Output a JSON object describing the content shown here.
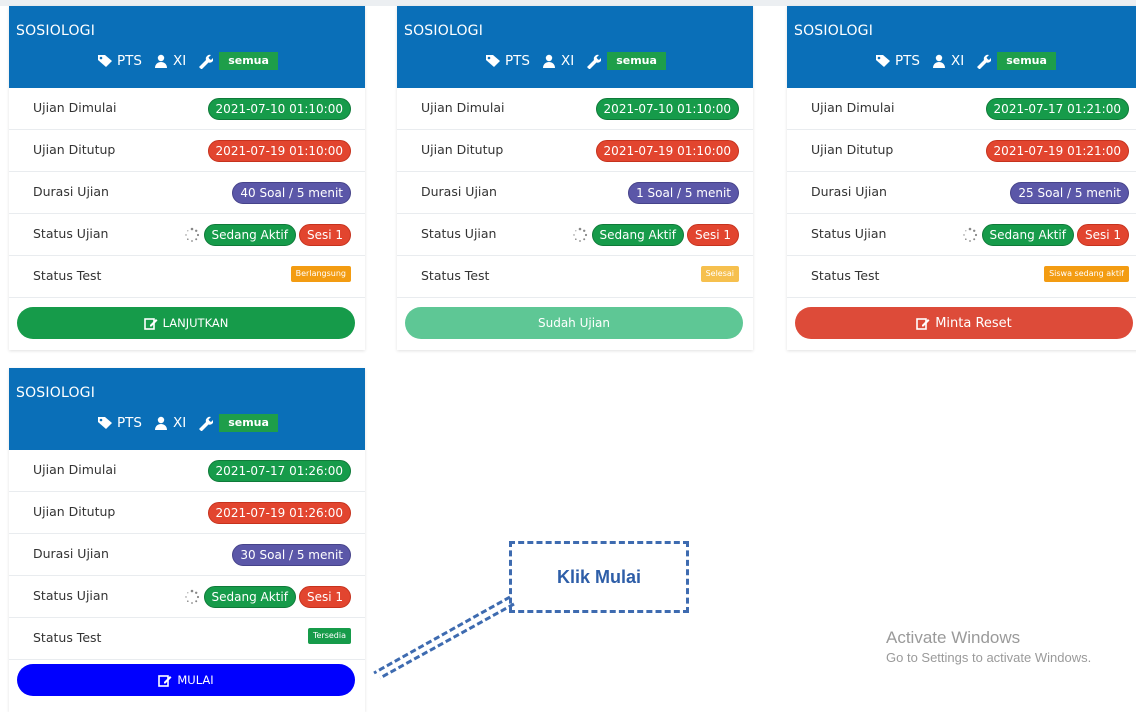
{
  "cards": [
    {
      "title": "SOSIOLOGI",
      "type": "PTS",
      "kelas": "XI",
      "group": "semua",
      "rows": {
        "mulai_label": "Ujian Dimulai",
        "mulai_value": "2021-07-10 01:10:00",
        "tutup_label": "Ujian Ditutup",
        "tutup_value": "2021-07-19 01:10:00",
        "durasi_label": "Durasi Ujian",
        "durasi_value": "40 Soal / 5 menit",
        "status_ujian_label": "Status Ujian",
        "status_ujian_value": "Sedang Aktif",
        "sesi": "Sesi 1",
        "status_test_label": "Status Test",
        "status_test_value": "Berlangsung"
      },
      "button": "LANJUTKAN"
    },
    {
      "title": "SOSIOLOGI",
      "type": "PTS",
      "kelas": "XI",
      "group": "semua",
      "rows": {
        "mulai_label": "Ujian Dimulai",
        "mulai_value": "2021-07-10 01:10:00",
        "tutup_label": "Ujian Ditutup",
        "tutup_value": "2021-07-19 01:10:00",
        "durasi_label": "Durasi Ujian",
        "durasi_value": "1 Soal / 5 menit",
        "status_ujian_label": "Status Ujian",
        "status_ujian_value": "Sedang Aktif",
        "sesi": "Sesi 1",
        "status_test_label": "Status Test",
        "status_test_value": "Selesai"
      },
      "button": "Sudah Ujian"
    },
    {
      "title": "SOSIOLOGI",
      "type": "PTS",
      "kelas": "XI",
      "group": "semua",
      "rows": {
        "mulai_label": "Ujian Dimulai",
        "mulai_value": "2021-07-17 01:21:00",
        "tutup_label": "Ujian Ditutup",
        "tutup_value": "2021-07-19 01:21:00",
        "durasi_label": "Durasi Ujian",
        "durasi_value": "25 Soal / 5 menit",
        "status_ujian_label": "Status Ujian",
        "status_ujian_value": "Sedang Aktif",
        "sesi": "Sesi 1",
        "status_test_label": "Status Test",
        "status_test_value": "Siswa sedang aktif"
      },
      "button": "Minta Reset"
    },
    {
      "title": "SOSIOLOGI",
      "type": "PTS",
      "kelas": "XI",
      "group": "semua",
      "rows": {
        "mulai_label": "Ujian Dimulai",
        "mulai_value": "2021-07-17 01:26:00",
        "tutup_label": "Ujian Ditutup",
        "tutup_value": "2021-07-19 01:26:00",
        "durasi_label": "Durasi Ujian",
        "durasi_value": "30 Soal / 5 menit",
        "status_ujian_label": "Status Ujian",
        "status_ujian_value": "Sedang Aktif",
        "sesi": "Sesi 1",
        "status_test_label": "Status Test",
        "status_test_value": "Tersedia"
      },
      "button": "MULAI"
    }
  ],
  "callout": "Klik Mulai",
  "watermark": {
    "line1": "Activate Windows",
    "line2": "Go to Settings to activate Windows."
  },
  "icons": {
    "type": "tag-icon",
    "kelas": "user-icon",
    "group": "wrench-icon",
    "status": "spinner-icon",
    "button": "edit-icon"
  },
  "colors": {
    "header": "#0a6fb8",
    "green": "#169b4a",
    "red": "#dd4b39",
    "purple": "#5b57a8",
    "blue_button": "#0000ff",
    "callout": "#3e6bb0"
  }
}
